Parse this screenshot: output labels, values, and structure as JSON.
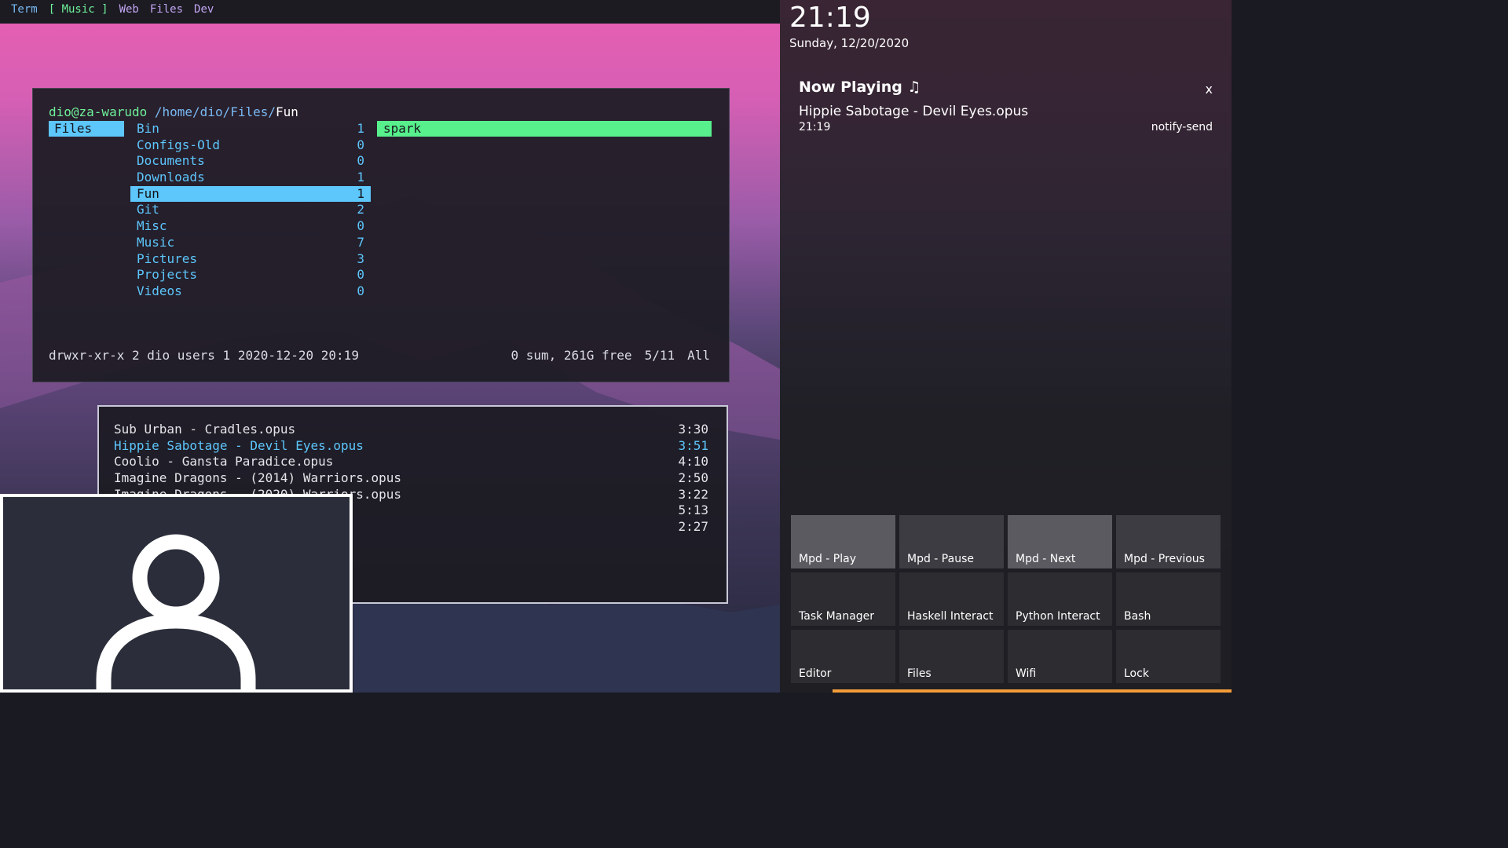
{
  "colors": {
    "accent_blue": "#5dc6fb",
    "accent_green": "#57f08c",
    "accent_orange": "#f39c3a",
    "panel_bg": "#1c1b22"
  },
  "topbar": {
    "workspaces": [
      "Term",
      "[ Music ]",
      "Web",
      "Files",
      "Dev"
    ],
    "active_index": 1
  },
  "file_manager": {
    "host": "dio@za-warudo",
    "path_dirs": "/home/dio/Files/",
    "path_current": "Fun",
    "parent_entry": "Files",
    "entries": [
      {
        "name": "Bin",
        "count": "1"
      },
      {
        "name": "Configs-Old",
        "count": "0"
      },
      {
        "name": "Documents",
        "count": "0"
      },
      {
        "name": "Downloads",
        "count": "1"
      },
      {
        "name": "Fun",
        "count": "1"
      },
      {
        "name": "Git",
        "count": "2"
      },
      {
        "name": "Misc",
        "count": "0"
      },
      {
        "name": "Music",
        "count": "7"
      },
      {
        "name": "Pictures",
        "count": "3"
      },
      {
        "name": "Projects",
        "count": "0"
      },
      {
        "name": "Videos",
        "count": "0"
      }
    ],
    "selected_index": 4,
    "preview_entry": "spark",
    "status_left": "drwxr-xr-x 2 dio users 1 2020-12-20 20:19",
    "status_usage": "0 sum, 261G free",
    "status_position": "5/11",
    "status_scroll": "All"
  },
  "music_player": {
    "tracks": [
      {
        "title": "Sub Urban - Cradles.opus",
        "duration": "3:30"
      },
      {
        "title": "Hippie Sabotage - Devil Eyes.opus",
        "duration": "3:51"
      },
      {
        "title": "Coolio - Gansta Paradice.opus",
        "duration": "4:10"
      },
      {
        "title": "Imagine Dragons - (2014) Warriors.opus",
        "duration": "2:50"
      },
      {
        "title": "Imagine Dragons - (2020) Warriors.opus",
        "duration": "3:22"
      },
      {
        "title": "",
        "duration": "5:13"
      },
      {
        "title": "",
        "duration": "2:27"
      }
    ],
    "playing_index": 1
  },
  "sidebar": {
    "clock_time": "21:19",
    "clock_date": "Sunday, 12/20/2020",
    "notification": {
      "title": "Now Playing ♫",
      "close": "x",
      "body": "Hippie Sabotage - Devil Eyes.opus",
      "time": "21:19",
      "app": "notify-send"
    },
    "buttons": [
      "Mpd - Play",
      "Mpd - Pause",
      "Mpd - Next",
      "Mpd - Previous",
      "Task Manager",
      "Haskell Interact",
      "Python Interact",
      "Bash",
      "Editor",
      "Files",
      "Wifi",
      "Lock"
    ]
  }
}
